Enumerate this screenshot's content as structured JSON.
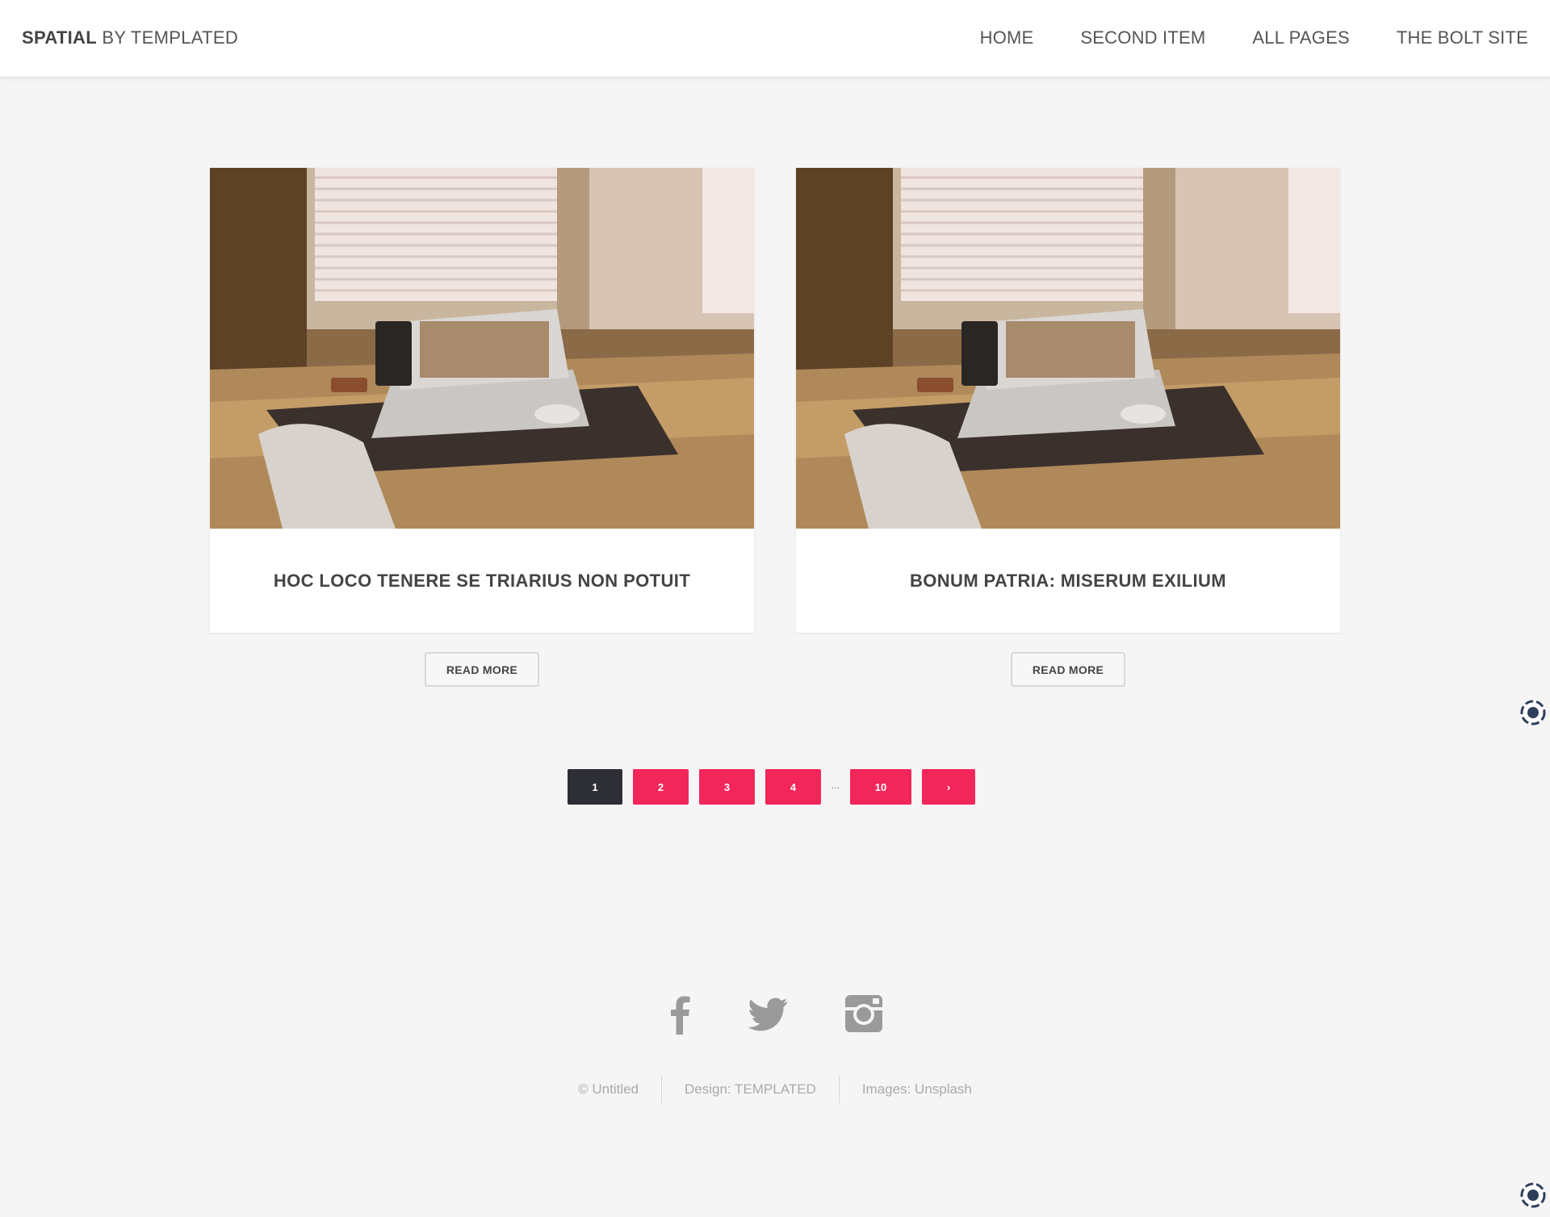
{
  "header": {
    "logo_strong": "SPATIAL",
    "logo_rest": " BY TEMPLATED",
    "nav": [
      "HOME",
      "SECOND ITEM",
      "ALL PAGES",
      "THE BOLT SITE"
    ]
  },
  "posts": [
    {
      "title": "HOC LOCO TENERE SE TRIARIUS NON POTUIT",
      "button": "READ MORE"
    },
    {
      "title": "BONUM PATRIA: MISERUM EXILIUM",
      "button": "READ MORE"
    }
  ],
  "pagination": {
    "pages": [
      "1",
      "2",
      "3",
      "4",
      "10"
    ],
    "active": "1",
    "ellipsis": "...",
    "next": "›"
  },
  "social": [
    "facebook-icon",
    "twitter-icon",
    "instagram-icon"
  ],
  "footer": {
    "copyright": "© Untitled",
    "design": "Design: TEMPLATED",
    "images": "Images: Unsplash"
  },
  "colors": {
    "accent": "#f2265a",
    "active_page": "#2e2f36",
    "background": "#f5f5f5"
  }
}
